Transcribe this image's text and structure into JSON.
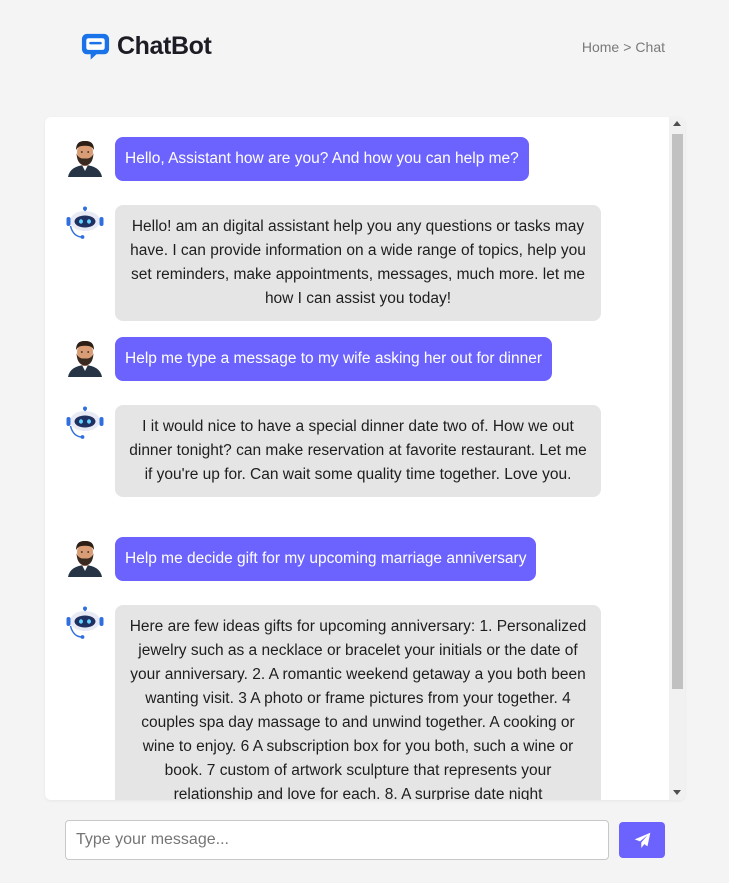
{
  "app": {
    "name": "ChatBot"
  },
  "breadcrumb": {
    "home": "Home",
    "separator": ">",
    "current": "Chat"
  },
  "messages": [
    {
      "role": "user",
      "avatar": "man-avatar-icon",
      "text": "Hello, Assistant how are you? And how you can help me?"
    },
    {
      "role": "bot",
      "avatar": "robot-avatar-icon",
      "text": "Hello! am an digital assistant help you any questions or tasks may have. I can provide information on a wide range of topics, help you set reminders, make appointments, messages, much more. let me how I can assist you today!"
    },
    {
      "role": "user",
      "avatar": "man-avatar-icon",
      "text": "Help me type a message to my wife asking her out for dinner"
    },
    {
      "role": "bot",
      "avatar": "robot-avatar-icon",
      "text": "I it would nice to have a special dinner date two of. How we out dinner tonight? can make reservation at favorite restaurant. Let me if you're up for. Can wait some quality time together. Love you."
    },
    {
      "role": "user",
      "avatar": "man-avatar-icon",
      "text": "Help me decide gift for my upcoming marriage anniversary"
    },
    {
      "role": "bot",
      "avatar": "robot-avatar-icon",
      "text": "Here are few ideas gifts for upcoming anniversary: 1. Personalized jewelry such as a necklace or bracelet your initials or the date of your anniversary. 2. A romantic weekend getaway a you both been wanting visit. 3 A photo or frame pictures from your together. 4 couples spa day massage to and unwind together. A cooking or wine to enjoy. 6 A subscription box for you both, such a wine or book. 7 custom of artwork sculpture that represents your relationship and love for each. 8. A surprise date night"
    }
  ],
  "composer": {
    "placeholder": "Type your message...",
    "value": "",
    "send_icon": "paper-plane-icon"
  },
  "colors": {
    "accent": "#6c63ff",
    "bot_bubble": "#e5e5e5",
    "background": "#f4f4f4",
    "logo_blue": "#1a73e8"
  }
}
